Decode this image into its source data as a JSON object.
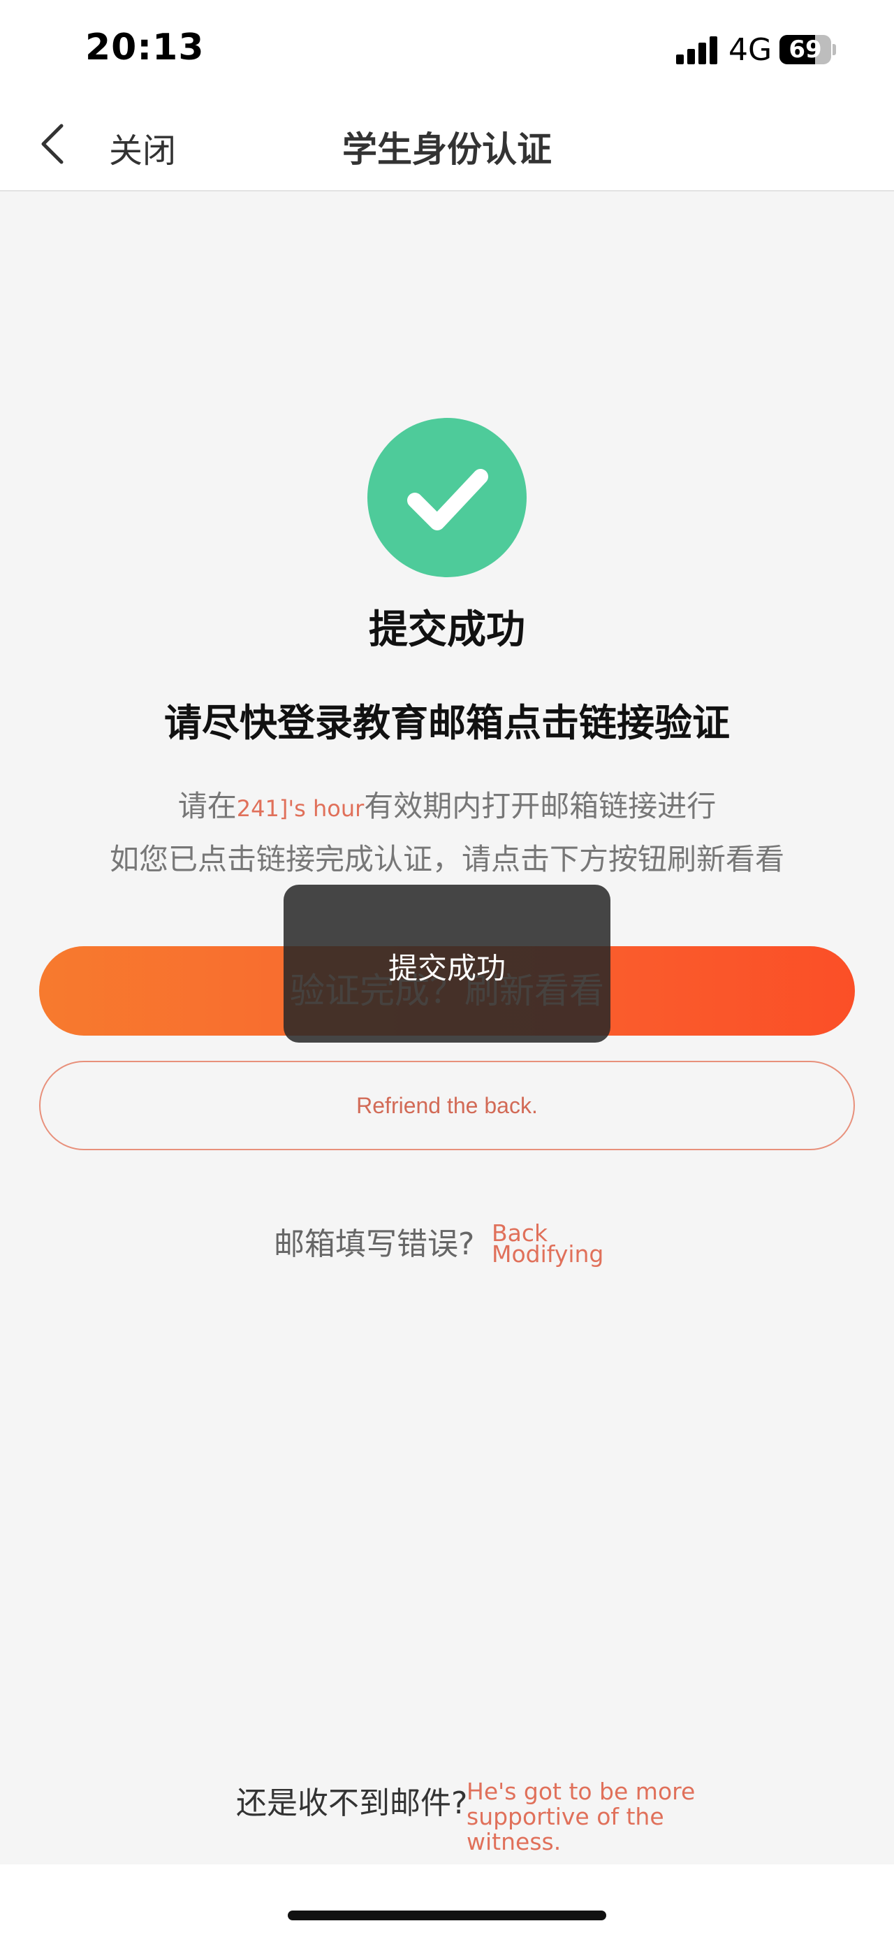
{
  "status_bar": {
    "time": "20:13",
    "network": "4G",
    "battery": "69",
    "battery_level": 0.69,
    "signal_icon": "signal-bars-icon"
  },
  "nav": {
    "back_icon": "chevron-left-icon",
    "close_label": "关闭",
    "title": "学生身份认证"
  },
  "main": {
    "success_icon": "check-circle-icon",
    "success_color": "#4ecb9a",
    "success_title": "提交成功",
    "instruction_heading": "请尽快登录教育邮箱点击链接验证",
    "info_prefix": "请在",
    "info_highlight": "241]'s hour",
    "info_suffix": "有效期内打开邮箱链接进行",
    "info_line2": "如您已点击链接完成认证，请点击下方按钮刷新看看",
    "refresh_button": "验证完成？刷新看看",
    "resend_button": "Refriend the back.",
    "email_wrong_label": "邮箱填写错误?",
    "email_modify_link": "Back Modifying",
    "no_email_label": "还是收不到邮件?",
    "support_link": "He's got to be more supportive of the witness.",
    "accent_color": "#f96530"
  },
  "toast": {
    "text": "提交成功"
  }
}
